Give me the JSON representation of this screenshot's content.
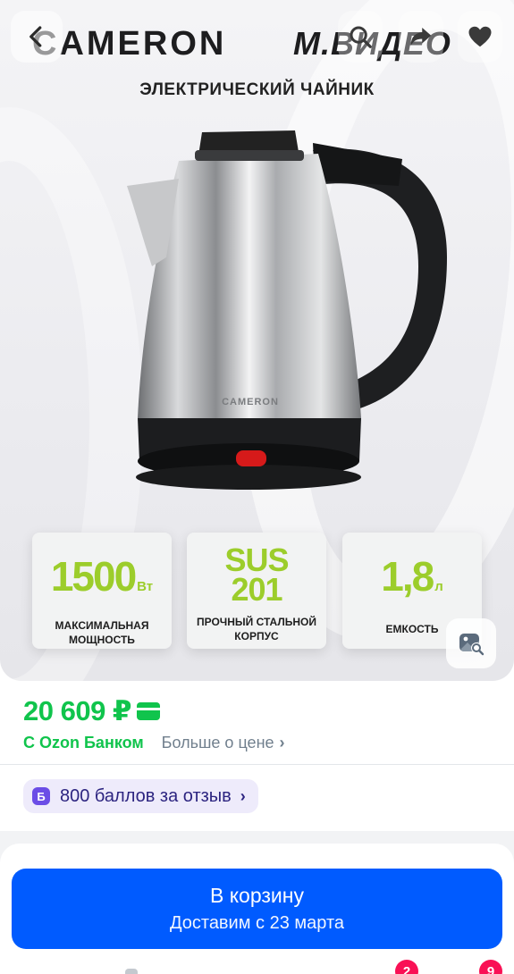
{
  "header": {
    "back_icon": "chevron-left-icon",
    "search_icon": "search-icon",
    "share_icon": "share-icon",
    "favorite_icon": "heart-icon"
  },
  "product_image": {
    "brand_left": "CAMERON",
    "brand_right": "М.ВИДЕО",
    "subtitle": "ЭЛЕКТРИЧЕСКИЙ ЧАЙНИК",
    "kettle_engraving": "CAMERON",
    "features": [
      {
        "value": "1500",
        "unit": "Вт",
        "label_line1": "МАКСИМАЛЬНАЯ",
        "label_line2": "МОЩНОСТЬ"
      },
      {
        "value_line1": "SUS",
        "value_line2": "201",
        "label_line1": "ПРОЧНЫЙ СТАЛЬНОЙ",
        "label_line2": "КОРПУС"
      },
      {
        "value": "1,8",
        "unit": "л",
        "label_line1": "ЕМКОСТЬ"
      }
    ],
    "image_search_icon": "image-search-icon"
  },
  "price": {
    "amount": "20 609 ₽",
    "bank_label": "С Ozon Банком",
    "more_link": "Больше о цене",
    "chevron": "›"
  },
  "points": {
    "icon_letter": "Б",
    "text": "800 баллов за отзыв",
    "chevron": "›"
  },
  "cart": {
    "title": "В корзину",
    "subtitle": "Доставим с 23 марта"
  },
  "tabbar": {
    "badges": [
      "2",
      "9"
    ]
  },
  "colors": {
    "accent_blue": "#005bff",
    "price_green": "#10c44c",
    "feature_green": "#9ccd2b",
    "points_purple": "#6b4de6",
    "badge_pink": "#f91155"
  }
}
